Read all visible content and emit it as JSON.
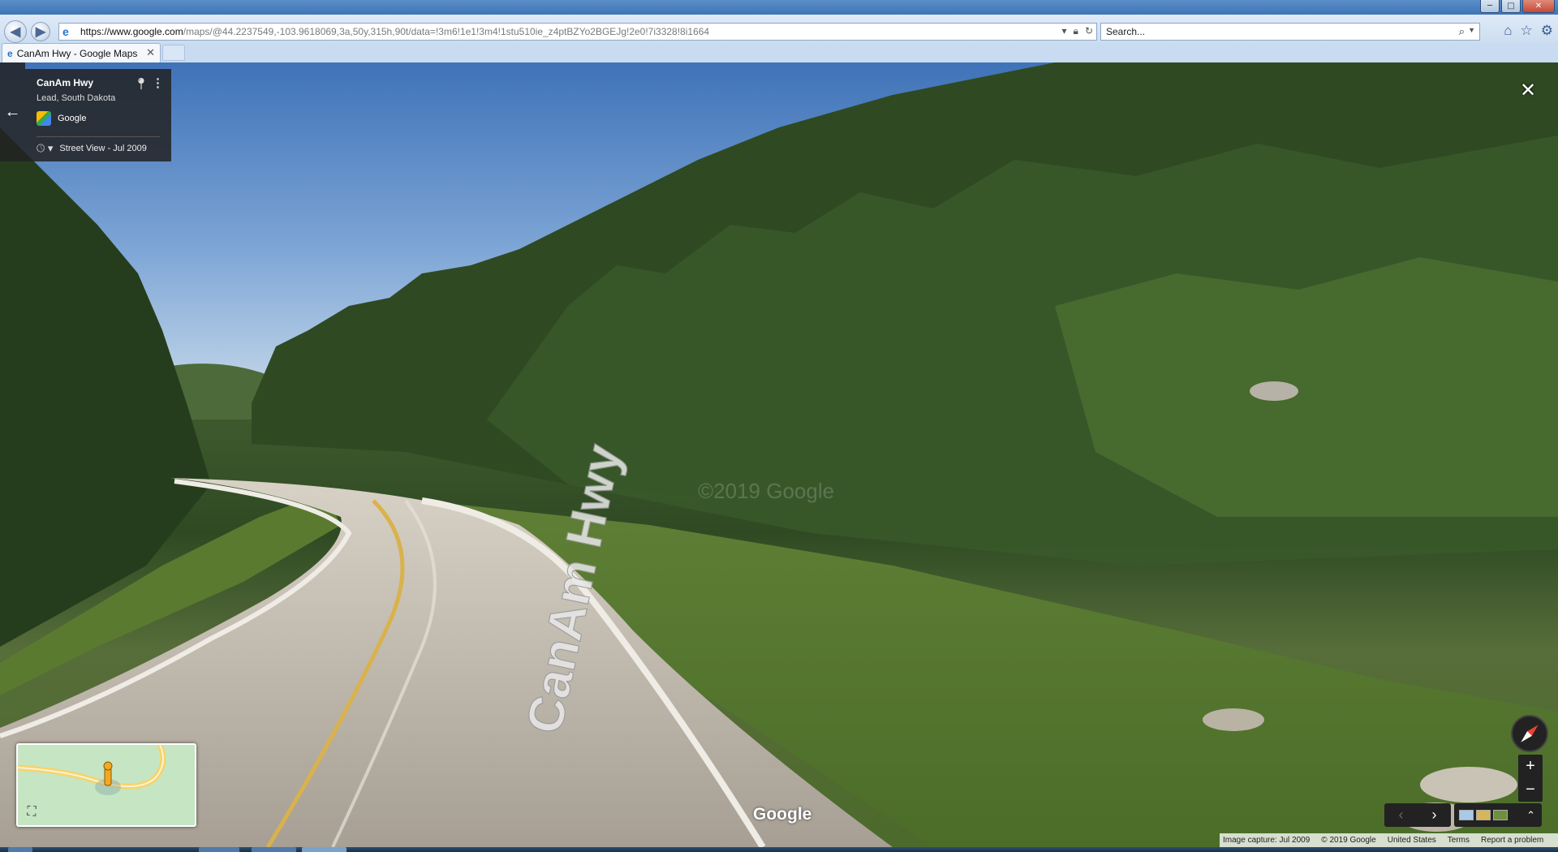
{
  "browser": {
    "url_host": "https://www.google.com",
    "url_path": "/maps/@44.2237549,-103.9618069,3a,50y,315h,90t/data=!3m6!1e1!3m4!1stu510ie_z4ptBZYo2BGEJg!2e0!7i3328!8i1664",
    "search_placeholder": "Search...",
    "tab_title": "CanAm Hwy - Google Maps",
    "icons": [
      "back-icon",
      "forward-icon",
      "ie-icon",
      "dropdown-icon",
      "lock-icon",
      "refresh-icon",
      "search-icon",
      "home-icon",
      "favorites-star-icon",
      "settings-gear-icon"
    ]
  },
  "window": {
    "minimize": "─",
    "maximize": "□",
    "close": "✕"
  },
  "streetview": {
    "place_title": "CanAm Hwy",
    "place_subtitle": "Lead, South Dakota",
    "provider": "Google",
    "history_label": "Street View - Jul 2009",
    "watermark": "©2019 Google",
    "road_label": "CanAm Hwy",
    "google_logo": "Google",
    "close_glyph": "✕",
    "back_glyph": "←"
  },
  "controls": {
    "zoom_in": "+",
    "zoom_out": "−",
    "prev": "‹",
    "next": "›",
    "expand": "⌃",
    "fullscreen": "⛶"
  },
  "footer": {
    "image_capture": "Image capture: Jul 2009",
    "copyright": "© 2019 Google",
    "region": "United States",
    "terms": "Terms",
    "report": "Report a problem"
  },
  "colors": {
    "chrome_bg": "#c9dbf0",
    "panel_bg": "#222222",
    "sky": "#7fa8d6",
    "forest": "#2f4a23",
    "grass": "#5b7d34",
    "road": "#b8b2a8",
    "road_center_line": "#d9b24c"
  }
}
